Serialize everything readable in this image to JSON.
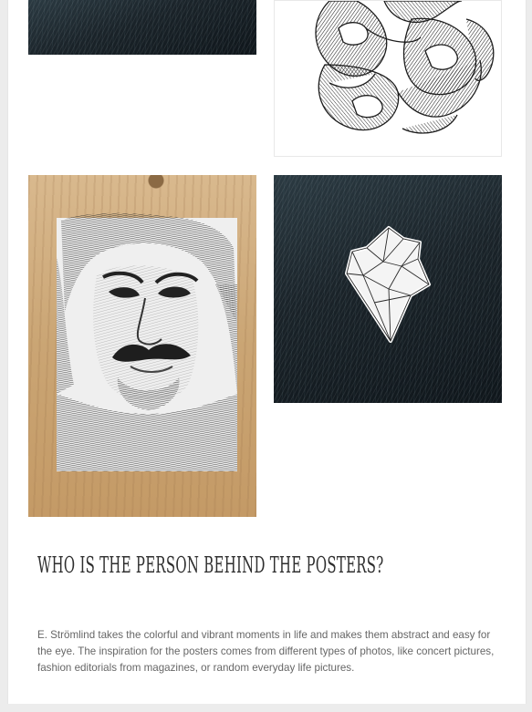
{
  "gallery": {
    "images": [
      {
        "name": "fur-texture-top"
      },
      {
        "name": "abstract-line-drawing"
      },
      {
        "name": "portrait-drawing-on-wood"
      },
      {
        "name": "geometric-pin-on-fur"
      }
    ]
  },
  "about": {
    "heading": "Who is the person behind the posters?",
    "body": "E. Strömlind takes the colorful and vibrant moments in life and makes them abstract and easy for the eye. The inspiration for the posters comes from different types of photos, like concert pictures, fashion editorials from magazines, or random everyday life pictures."
  },
  "colors": {
    "page_background": "#ececec",
    "card_background": "#ffffff",
    "heading_text": "#2e2e2e",
    "body_text": "#666666"
  }
}
